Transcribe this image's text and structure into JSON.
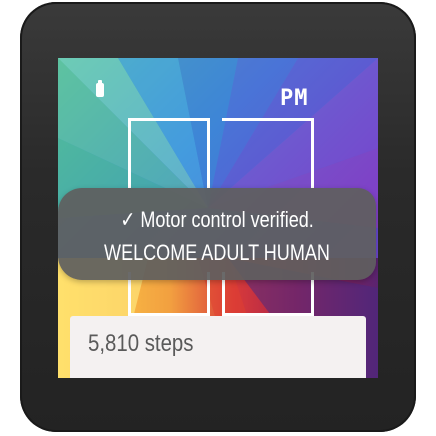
{
  "watch": {
    "ampm": "PM",
    "battery_icon": "battery-icon"
  },
  "toast": {
    "check_symbol": "✓",
    "line1": "Motor control verified.",
    "line2": "WELCOME ADULT HUMAN"
  },
  "card": {
    "steps_text": "5,810 steps"
  },
  "colors": {
    "toast_bg": "#5f5f5f",
    "card_bg": "#f4f1f1",
    "bezel": "#2c2c2c"
  }
}
